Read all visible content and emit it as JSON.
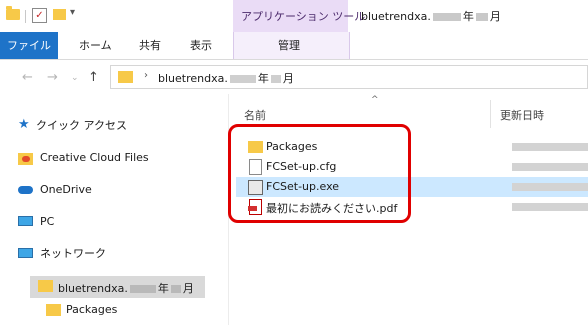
{
  "titlebar": {
    "context_tab": "アプリケーション ツール",
    "window_title_prefix": "bluetrendxa.",
    "window_title_year": "年",
    "window_title_month": "月"
  },
  "ribbon": {
    "tabs": [
      "ファイル",
      "ホーム",
      "共有",
      "表示",
      "管理"
    ]
  },
  "address": {
    "path_prefix": "bluetrendxa.",
    "path_year": "年",
    "path_month": "月"
  },
  "navpane": {
    "items": [
      {
        "label": "クイック アクセス",
        "icon": "star-icon"
      },
      {
        "label": "Creative Cloud Files",
        "icon": "creative-cloud-icon"
      },
      {
        "label": "OneDrive",
        "icon": "cloud-icon"
      },
      {
        "label": "PC",
        "icon": "monitor-icon"
      },
      {
        "label": "ネットワーク",
        "icon": "network-icon"
      }
    ],
    "current_folder_prefix": "bluetrendxa.",
    "current_folder_year": "年",
    "current_folder_month": "月",
    "subfolder": "Packages"
  },
  "filelist": {
    "col_name": "名前",
    "col_date": "更新日時",
    "files": [
      {
        "name": "Packages",
        "type": "folder"
      },
      {
        "name": "FCSet-up.cfg",
        "type": "file"
      },
      {
        "name": "FCSet-up.exe",
        "type": "exe",
        "selected": true
      },
      {
        "name": "最初にお読みください.pdf",
        "type": "pdf"
      }
    ]
  },
  "colors": {
    "file_tab": "#1e73c8",
    "context_tab": "#eadcf6",
    "selection": "#cce8ff",
    "highlight": "#e00000"
  }
}
